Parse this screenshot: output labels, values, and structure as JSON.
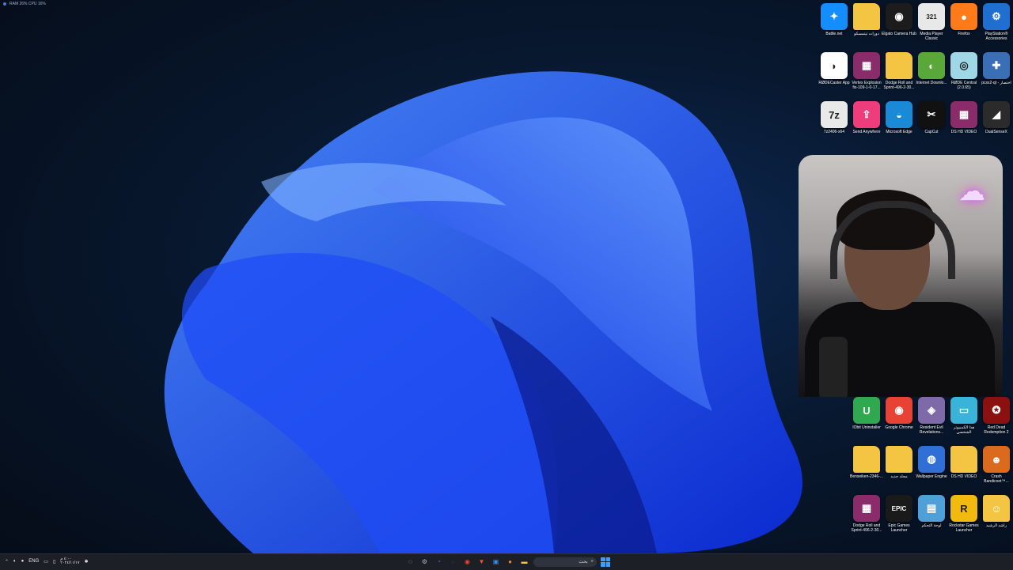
{
  "overlay": {
    "text": "RAM 26%  CPU 16%"
  },
  "desktop_icons": [
    {
      "label": "Battle.net",
      "icon": "battlenet-icon",
      "color": "#148eff",
      "glyph": "✦"
    },
    {
      "label": "دورات تيتمسكو",
      "icon": "folder-icon",
      "color": "#f4c542",
      "glyph": ""
    },
    {
      "label": "Elgato Camera Hub",
      "icon": "camera-icon",
      "color": "#1c1c1c",
      "glyph": "◉"
    },
    {
      "label": "Media Player Classic",
      "icon": "media-player-icon",
      "color": "#e8e8e8",
      "glyph": "321"
    },
    {
      "label": "Firefox",
      "icon": "firefox-icon",
      "color": "#ff7a18",
      "glyph": "●"
    },
    {
      "label": "PlayStation® Accessories",
      "icon": "playstation-icon",
      "color": "#1f6fd1",
      "glyph": "⚙"
    },
    {
      "label": "RØDECaster App",
      "icon": "rodecaster-icon",
      "color": "#ffffff",
      "glyph": "◗"
    },
    {
      "label": "Vertex Explosion fix-109-1-0-17...",
      "icon": "winrar-icon",
      "color": "#8a2b6a",
      "glyph": "▦"
    },
    {
      "label": "Dodge Roll and Sprint-496-2-30...",
      "icon": "folder-icon",
      "color": "#f4c542",
      "glyph": ""
    },
    {
      "label": "Internet Downlo...",
      "icon": "idm-icon",
      "color": "#5aa83a",
      "glyph": "◐"
    },
    {
      "label": "RØDE Central (2.0.65)",
      "icon": "rode-central-icon",
      "color": "#9fd7e6",
      "glyph": "◎"
    },
    {
      "label": "pcsx2-qt - اختصار",
      "icon": "pcsx2-icon",
      "color": "#3a6fb6",
      "glyph": "✚"
    },
    {
      "label": "7z2406-x64",
      "icon": "7zip-icon",
      "color": "#e9e9e9",
      "glyph": "7z"
    },
    {
      "label": "Send Anywhere",
      "icon": "send-anywhere-icon",
      "color": "#ee3d7a",
      "glyph": "⇪"
    },
    {
      "label": "Microsoft Edge",
      "icon": "edge-icon",
      "color": "#1b8ad6",
      "glyph": "◒"
    },
    {
      "label": "CapCut",
      "icon": "capcut-icon",
      "color": "#111111",
      "glyph": "✂"
    },
    {
      "label": "DS HD VIDEO",
      "icon": "winrar-icon",
      "color": "#8a2b6a",
      "glyph": "▦"
    },
    {
      "label": "DualSenseX",
      "icon": "dualsensex-icon",
      "color": "#2b2b2b",
      "glyph": "◢"
    },
    {
      "label": "IObit Uninstaller",
      "icon": "iobit-icon",
      "color": "#2fa84f",
      "glyph": "U"
    },
    {
      "label": "Google Chrome",
      "icon": "chrome-icon",
      "color": "#e84235",
      "glyph": "◉"
    },
    {
      "label": "Resident Evil Revelations...",
      "icon": "resident-evil-icon",
      "color": "#7e6aa8",
      "glyph": "◈"
    },
    {
      "label": "هذا الكمبيوتر الشخصي",
      "icon": "this-pc-icon",
      "color": "#39b3d7",
      "glyph": "▭"
    },
    {
      "label": "Red Dead Redemption 2",
      "icon": "rdr2-icon",
      "color": "#8b1010",
      "glyph": "✪"
    },
    {
      "label": "Benseiken-2346-...",
      "icon": "folder-icon",
      "color": "#f4c542",
      "glyph": ""
    },
    {
      "label": "مجلد جديد",
      "icon": "folder-icon",
      "color": "#f4c542",
      "glyph": ""
    },
    {
      "label": "Wallpaper Engine",
      "icon": "wallpaper-engine-icon",
      "color": "#2f6fd6",
      "glyph": "◍"
    },
    {
      "label": "DS HD VIDEO",
      "icon": "folder-icon",
      "color": "#f4c542",
      "glyph": ""
    },
    {
      "label": "Crash Bandicoot™...",
      "icon": "crash-icon",
      "color": "#d96a1e",
      "glyph": "☻"
    },
    {
      "label": "Dodge Roll and Sprint-496-2-30...",
      "icon": "winrar-icon",
      "color": "#8a2b6a",
      "glyph": "▦"
    },
    {
      "label": "Epic Games Launcher",
      "icon": "epic-games-icon",
      "color": "#1a1a1a",
      "glyph": "EPIC"
    },
    {
      "label": "لوحة التحكم",
      "icon": "control-panel-icon",
      "color": "#4fa0d8",
      "glyph": "▤"
    },
    {
      "label": "Rockstar Games Launcher",
      "icon": "rockstar-icon",
      "color": "#f2b90f",
      "glyph": "R"
    },
    {
      "label": "راشد الرشيد",
      "icon": "user-folder-icon",
      "color": "#f4c542",
      "glyph": "☺"
    }
  ],
  "webcam": {
    "neon_icon": "cloud-lightning-neon-icon"
  },
  "taskbar": {
    "tray": {
      "lang": "ENG",
      "time": "٤:٠٠ م",
      "date": "٢٠٢٤/١١/١٧"
    },
    "search_placeholder": "بحث",
    "pinned": [
      {
        "icon": "settings-icon",
        "color": "#aeb6c2",
        "glyph": "⚙"
      },
      {
        "icon": "discord-icon",
        "color": "#5865f2",
        "glyph": "◔"
      },
      {
        "icon": "steam-icon",
        "color": "#1b2838",
        "glyph": "◉"
      },
      {
        "icon": "chrome-icon",
        "color": "#e84235",
        "glyph": "◉"
      },
      {
        "icon": "brave-icon",
        "color": "#fb542b",
        "glyph": "▼"
      },
      {
        "icon": "store-icon",
        "color": "#3a8ee6",
        "glyph": "▣"
      },
      {
        "icon": "firefox-icon",
        "color": "#ff7a18",
        "glyph": "●"
      },
      {
        "icon": "file-explorer-icon",
        "color": "#f4c542",
        "glyph": "▬"
      }
    ]
  }
}
